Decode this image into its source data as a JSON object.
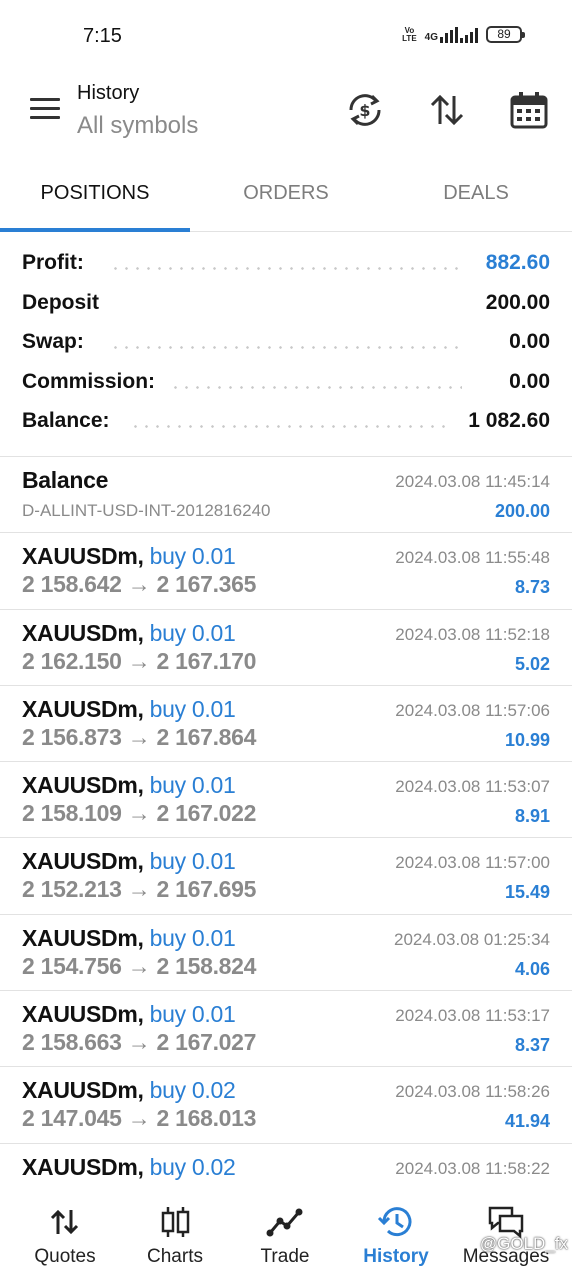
{
  "status_bar": {
    "time": "7:15",
    "volte_top": "Vo",
    "volte_bottom": "LTE",
    "network": "4G",
    "battery": "89"
  },
  "header": {
    "title": "History",
    "subtitle": "All symbols"
  },
  "tabs": [
    {
      "label": "POSITIONS",
      "active": true
    },
    {
      "label": "ORDERS",
      "active": false
    },
    {
      "label": "DEALS",
      "active": false
    }
  ],
  "summary": [
    {
      "label": "Profit:",
      "value": "882.60"
    },
    {
      "label": "Deposit",
      "value": "200.00"
    },
    {
      "label": "Swap:",
      "value": "0.00"
    },
    {
      "label": "Commission:",
      "value": "0.00"
    },
    {
      "label": "Balance:",
      "value": "1 082.60"
    }
  ],
  "balance_entry": {
    "title": "Balance",
    "account": "D-ALLINT-USD-INT-2012816240",
    "time": "2024.03.08 11:45:14",
    "amount": "200.00"
  },
  "positions": [
    {
      "symbol": "XAUUSDm,",
      "direction": "buy 0.01",
      "open": "2 158.642",
      "close": "2 167.365",
      "arrow": "→",
      "time": "2024.03.08 11:55:48",
      "profit": "8.73"
    },
    {
      "symbol": "XAUUSDm,",
      "direction": "buy 0.01",
      "open": "2 162.150",
      "close": "2 167.170",
      "arrow": "→",
      "time": "2024.03.08 11:52:18",
      "profit": "5.02"
    },
    {
      "symbol": "XAUUSDm,",
      "direction": "buy 0.01",
      "open": "2 156.873",
      "close": "2 167.864",
      "arrow": "→",
      "time": "2024.03.08 11:57:06",
      "profit": "10.99"
    },
    {
      "symbol": "XAUUSDm,",
      "direction": "buy 0.01",
      "open": "2 158.109",
      "close": "2 167.022",
      "arrow": "→",
      "time": "2024.03.08 11:53:07",
      "profit": "8.91"
    },
    {
      "symbol": "XAUUSDm,",
      "direction": "buy 0.01",
      "open": "2 152.213",
      "close": "2 167.695",
      "arrow": "→",
      "time": "2024.03.08 11:57:00",
      "profit": "15.49"
    },
    {
      "symbol": "XAUUSDm,",
      "direction": "buy 0.01",
      "open": "2 154.756",
      "close": "2 158.824",
      "arrow": "→",
      "time": "2024.03.08 01:25:34",
      "profit": "4.06"
    },
    {
      "symbol": "XAUUSDm,",
      "direction": "buy 0.01",
      "open": "2 158.663",
      "close": "2 167.027",
      "arrow": "→",
      "time": "2024.03.08 11:53:17",
      "profit": "8.37"
    },
    {
      "symbol": "XAUUSDm,",
      "direction": "buy 0.02",
      "open": "2 147.045",
      "close": "2 168.013",
      "arrow": "→",
      "time": "2024.03.08 11:58:26",
      "profit": "41.94"
    },
    {
      "symbol": "XAUUSDm,",
      "direction": "buy 0.02",
      "open": "",
      "close": "",
      "arrow": "",
      "time": "2024.03.08 11:58:22",
      "profit": ""
    }
  ],
  "bottom_nav": [
    {
      "label": "Quotes",
      "icon": "quotes-arrows-icon",
      "active": false
    },
    {
      "label": "Charts",
      "icon": "candlestick-icon",
      "active": false
    },
    {
      "label": "Trade",
      "icon": "trade-line-icon",
      "active": false
    },
    {
      "label": "History",
      "icon": "history-clock-icon",
      "active": true
    },
    {
      "label": "Messages",
      "icon": "messages-icon",
      "active": false
    }
  ],
  "watermark": "@GOLD_fx",
  "colors": {
    "accent": "#2a7fd4",
    "muted": "#8a8a8a",
    "text": "#111111",
    "divider": "#e2e2e2"
  }
}
